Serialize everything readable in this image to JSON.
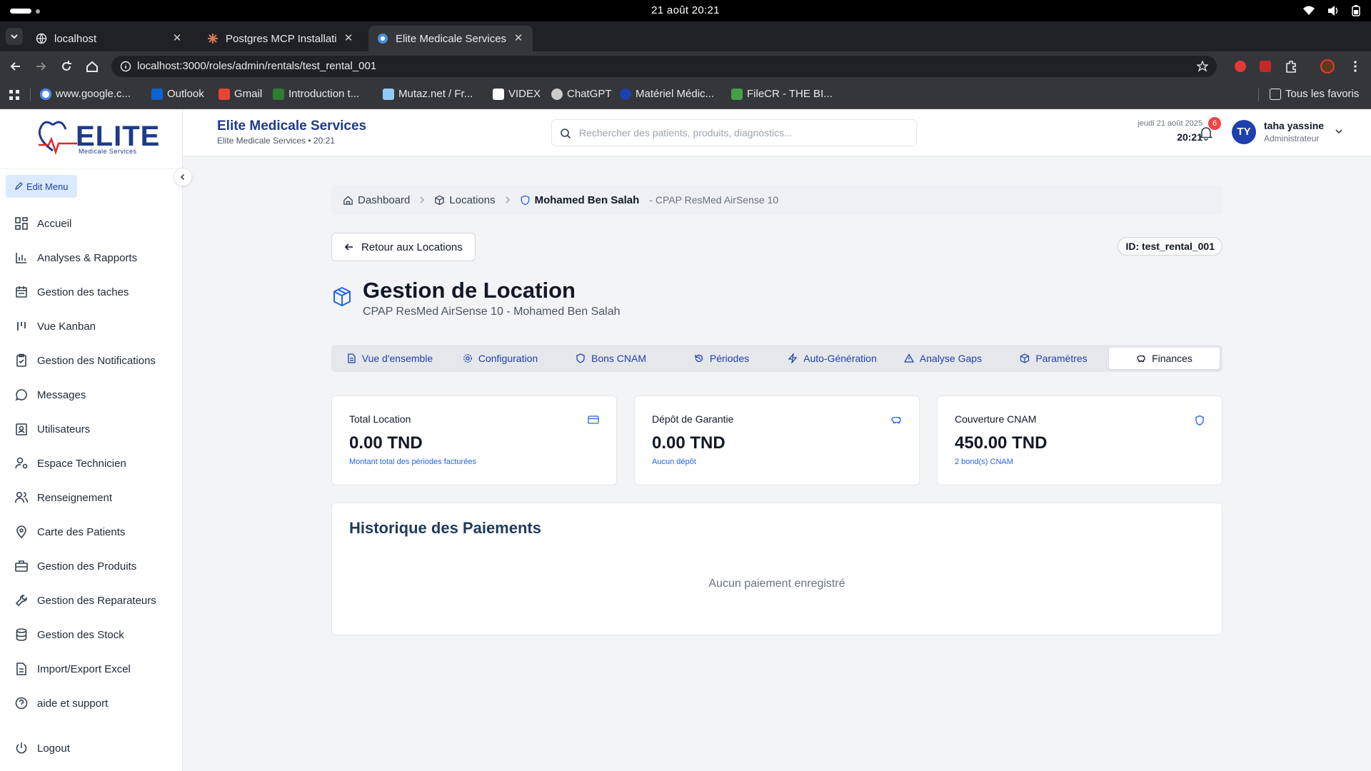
{
  "os": {
    "clock": "21 août  20:21"
  },
  "browser": {
    "tabs": [
      {
        "title": "localhost",
        "active": false
      },
      {
        "title": "Postgres MCP Installation",
        "active": false
      },
      {
        "title": "Elite Medicale Services | ",
        "active": true
      }
    ],
    "url": "localhost:3000/roles/admin/rentals/test_rental_001",
    "bookmarks": [
      "www.google.c...",
      "Outlook",
      "Gmail",
      "Introduction t...",
      "Mutaz.net / Fr...",
      "VIDEX",
      "ChatGPT",
      "Matériel Médic...",
      "FileCR - THE BI..."
    ],
    "all_bookmarks": "Tous les favoris"
  },
  "sidebar": {
    "logo": "ELITE",
    "logo_sub": "Medicale Services",
    "edit_menu": "Edit Menu",
    "items": [
      {
        "label": "Accueil",
        "icon": "grid-icon"
      },
      {
        "label": "Analyses & Rapports",
        "icon": "bar-chart-icon"
      },
      {
        "label": "Gestion des taches",
        "icon": "calendar-icon"
      },
      {
        "label": "Vue Kanban",
        "icon": "kanban-icon"
      },
      {
        "label": "Gestion des Notifications",
        "icon": "clipboard-check-icon"
      },
      {
        "label": "Messages",
        "icon": "message-icon"
      },
      {
        "label": "Utilisateurs",
        "icon": "contact-icon"
      },
      {
        "label": "Espace Technicien",
        "icon": "user-cog-icon"
      },
      {
        "label": "Renseignement",
        "icon": "users-icon"
      },
      {
        "label": "Carte des Patients",
        "icon": "map-pin-icon"
      },
      {
        "label": "Gestion des Produits",
        "icon": "briefcase-icon"
      },
      {
        "label": "Gestion des Reparateurs",
        "icon": "wrench-icon"
      },
      {
        "label": "Gestion des Stock",
        "icon": "database-icon"
      },
      {
        "label": "Import/Export Excel",
        "icon": "file-icon"
      },
      {
        "label": "aide et support",
        "icon": "help-icon"
      }
    ],
    "logout": "Logout"
  },
  "header": {
    "title": "Elite Medicale Services",
    "subtitle": "Elite Medicale Services • 20:21",
    "search_placeholder": "Rechercher des patients, produits, diagnostics...",
    "date": "jeudi 21 août 2025",
    "time": "20:21",
    "notifications": "6",
    "avatar": "TY",
    "user_name": "taha yassine",
    "user_role": "Administrateur"
  },
  "breadcrumb": {
    "home": "Dashboard",
    "section": "Locations",
    "current": "Mohamed Ben Salah",
    "extra": "- CPAP ResMed AirSense 10"
  },
  "page": {
    "back": "Retour aux Locations",
    "id_badge": "ID: test_rental_001",
    "title": "Gestion de Location",
    "subtitle": "CPAP ResMed AirSense 10 - Mohamed Ben Salah"
  },
  "tabs": [
    {
      "label": "Vue d'ensemble",
      "icon": "file-text-icon"
    },
    {
      "label": "Configuration",
      "icon": "settings-icon"
    },
    {
      "label": "Bons CNAM",
      "icon": "shield-icon"
    },
    {
      "label": "Périodes",
      "icon": "history-icon"
    },
    {
      "label": "Auto-Génération",
      "icon": "zap-icon"
    },
    {
      "label": "Analyse Gaps",
      "icon": "alert-triangle-icon"
    },
    {
      "label": "Paramètres",
      "icon": "package-icon"
    },
    {
      "label": "Finances",
      "icon": "piggy-bank-icon",
      "active": true
    }
  ],
  "cards": [
    {
      "title": "Total Location",
      "value": "0.00 TND",
      "sub": "Montant total des périodes facturées",
      "icon": "credit-card-icon"
    },
    {
      "title": "Dépôt de Garantie",
      "value": "0.00 TND",
      "sub": "Aucun dépôt",
      "icon": "piggy-bank-icon"
    },
    {
      "title": "Couverture CNAM",
      "value": "450.00 TND",
      "sub": "2 bond(s) CNAM",
      "icon": "shield-icon"
    }
  ],
  "history": {
    "title": "Historique des Paiements",
    "empty": "Aucun paiement enregistré"
  },
  "colors": {
    "primary": "#1e3a8a",
    "accent": "#2563eb",
    "badge": "#ef4444"
  }
}
